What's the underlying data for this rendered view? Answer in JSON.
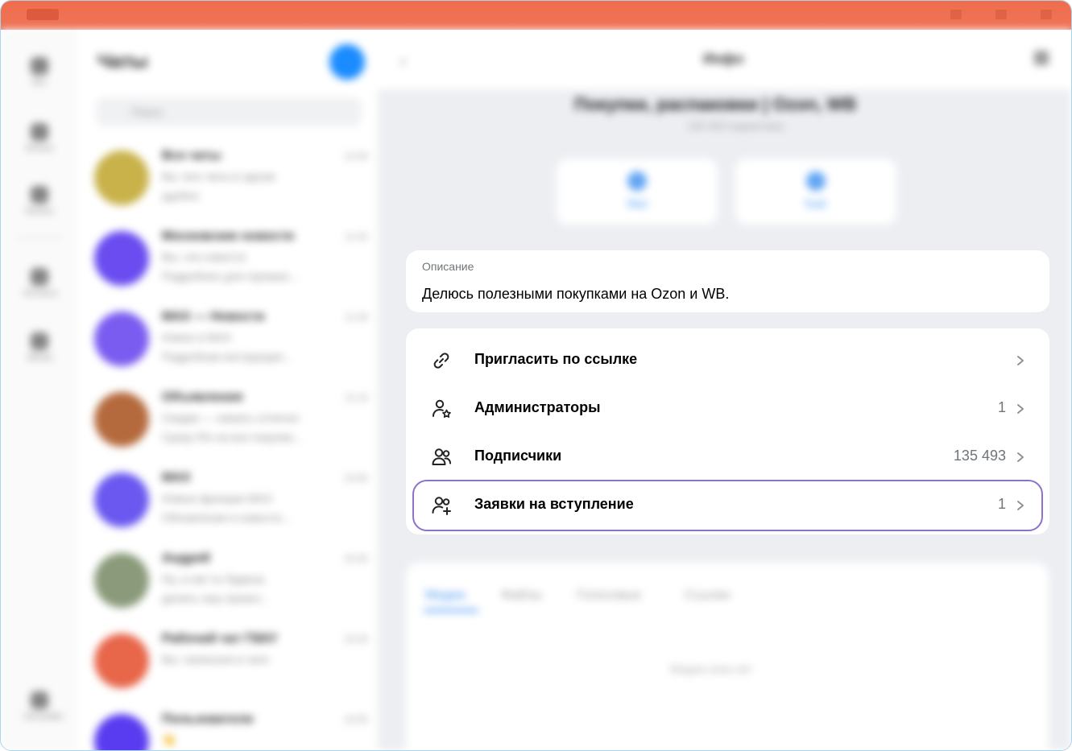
{
  "titlebar": {
    "app_name": "MAX"
  },
  "rail": {
    "items": [
      {
        "label": "Все",
        "icon": "chats-icon"
      },
      {
        "label": "Личные",
        "icon": "person-icon"
      },
      {
        "label": "Каналы",
        "icon": "channel-icon"
      },
      {
        "label": "Контакты",
        "icon": "contacts-icon"
      },
      {
        "label": "Звонки",
        "icon": "phone-icon"
      },
      {
        "label": "Настройки",
        "icon": "gear-icon"
      }
    ]
  },
  "chatlist": {
    "title": "Чаты",
    "search_placeholder": "Поиск",
    "chats": [
      {
        "name": "Все чаты",
        "time": "12:00",
        "line1": "Вы: все чаты в одном",
        "line2": "удобно",
        "color": "#c9b24a"
      },
      {
        "name": "Московские новости",
        "time": "11:42",
        "line1": "Вы: эти новости",
        "line2": "Подробнее для горожан...",
        "color": "#6a4cf0"
      },
      {
        "name": "MAX — Новости",
        "time": "11:30",
        "line1": "Новое в MAX",
        "line2": "Подробная инструкция...",
        "color": "#7a5cf0"
      },
      {
        "name": "Объявления",
        "time": "11:10",
        "line1": "Скидки — нажать отлично",
        "line2": "Сразу 5% на все покупки...",
        "color": "#b46a3c"
      },
      {
        "name": "MAX",
        "time": "10:55",
        "line1": "Новые функции MAX",
        "line2": "Обновления и новости...",
        "color": "#6a58f0"
      },
      {
        "name": "Андрей",
        "time": "10:40",
        "line1": "Ну, а как ты будешь",
        "line2": "делать наш проект...",
        "color": "#8a9a7a"
      },
      {
        "name": "Рабочий чат ГБКУ",
        "time": "10:20",
        "line1": "Вы: написали в чате",
        "line2": "",
        "color": "#e8664a"
      },
      {
        "name": "Пользователи",
        "time": "10:05",
        "line1": "👋",
        "line2": "",
        "color": "#5a3cf0"
      }
    ]
  },
  "header": {
    "title": "Инфо",
    "channel_name": "Покупки, распаковки | Ozon, WB",
    "channel_sub": "135 493 подписчика"
  },
  "actions": [
    {
      "label": "Звук"
    },
    {
      "label": "Ещё"
    }
  ],
  "description": {
    "label": "Описание",
    "text": "Делюсь полезными покупками на Ozon и WB."
  },
  "menu": {
    "items": [
      {
        "label": "Пригласить по ссылке",
        "value": "",
        "icon": "link-icon"
      },
      {
        "label": "Администраторы",
        "value": "1",
        "icon": "admin-star-icon"
      },
      {
        "label": "Подписчики",
        "value": "135 493",
        "icon": "subscribers-icon"
      },
      {
        "label": "Заявки на вступление",
        "value": "1",
        "icon": "add-user-icon"
      }
    ]
  },
  "media": {
    "tabs": [
      "Медиа",
      "Файлы",
      "Голосовые",
      "Ссылки"
    ],
    "empty_text": "Медиа пока нет"
  },
  "colors": {
    "highlight": "#8a73c8",
    "accent": "#3a8ff0",
    "titlebar": "#f06d4d"
  }
}
